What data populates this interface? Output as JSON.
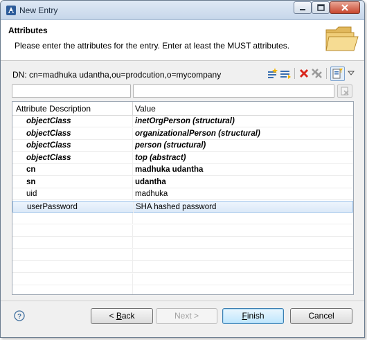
{
  "window": {
    "title": "New Entry"
  },
  "banner": {
    "title": "Attributes",
    "description": "Please enter the attributes for the entry. Enter at least the MUST attributes.",
    "icon": "folder-icon"
  },
  "dn": {
    "label": "DN: cn=madhuka udantha,ou=prodcution,o=mycompany"
  },
  "toolbar": {
    "icons": [
      "new-attribute-icon",
      "new-value-icon",
      "delete-icon",
      "delete-all-icon",
      "quick-filter-icon",
      "view-menu-icon"
    ]
  },
  "filters": {
    "attribute_value": "",
    "value_value": ""
  },
  "table": {
    "columns": [
      "Attribute Description",
      "Value"
    ],
    "rows": [
      {
        "attribute": "objectClass",
        "value": "inetOrgPerson (structural)",
        "style": "bi"
      },
      {
        "attribute": "objectClass",
        "value": "organizationalPerson (structural)",
        "style": "bi"
      },
      {
        "attribute": "objectClass",
        "value": "person (structural)",
        "style": "bi"
      },
      {
        "attribute": "objectClass",
        "value": "top (abstract)",
        "style": "bi"
      },
      {
        "attribute": "cn",
        "value": "madhuka udantha",
        "style": "b"
      },
      {
        "attribute": "sn",
        "value": "udantha",
        "style": "b"
      },
      {
        "attribute": "uid",
        "value": "madhuka",
        "style": "normal"
      },
      {
        "attribute": "userPassword",
        "value": "SHA hashed password",
        "style": "normal"
      }
    ],
    "selected_row": 7
  },
  "footer": {
    "back_prefix": "< ",
    "back_mnemonic": "B",
    "back_rest": "ack",
    "next_label": "Next >",
    "finish_mnemonic": "F",
    "finish_rest": "inish",
    "cancel_label": "Cancel"
  },
  "colors": {
    "selection": "#dbe9f8",
    "delete_red": "#d9261c"
  }
}
